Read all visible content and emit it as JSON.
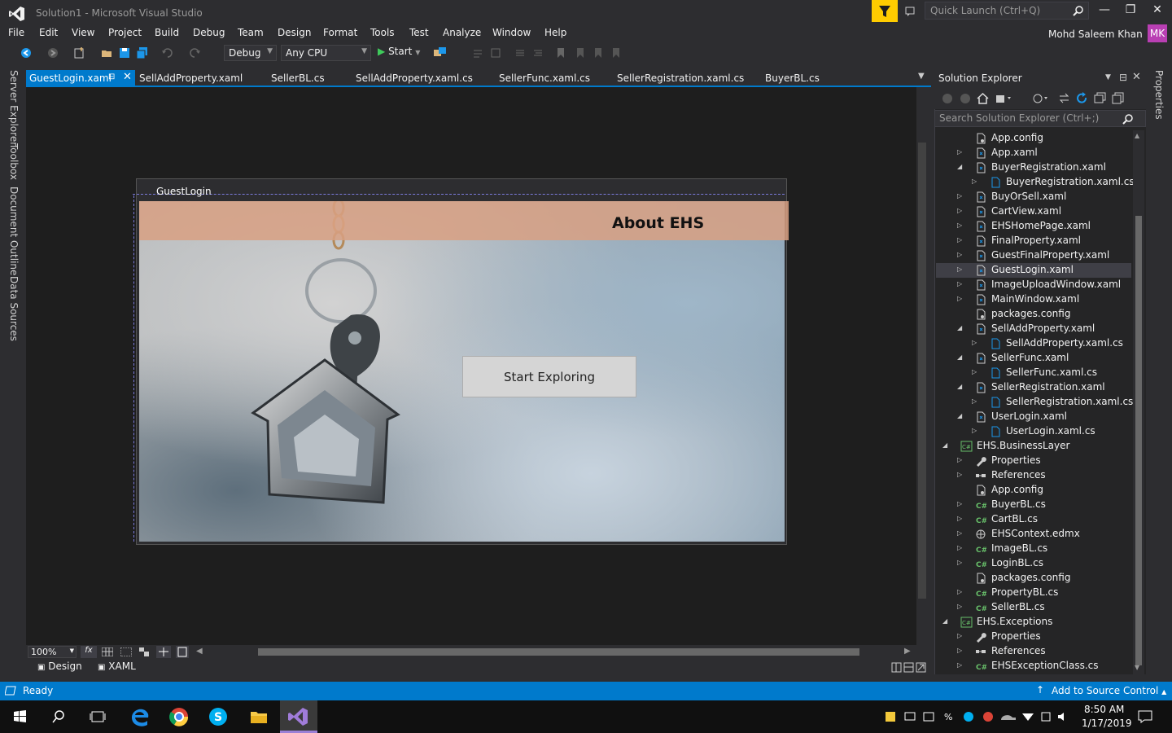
{
  "window": {
    "title": "Solution1 - Microsoft Visual Studio"
  },
  "quick_launch": {
    "placeholder": "Quick Launch (Ctrl+Q)"
  },
  "menu": [
    "File",
    "Edit",
    "View",
    "Project",
    "Build",
    "Debug",
    "Team",
    "Design",
    "Format",
    "Tools",
    "Test",
    "Analyze",
    "Window",
    "Help"
  ],
  "user": {
    "name": "Mohd Saleem Khan",
    "initials": "MK"
  },
  "toolbar": {
    "config": "Debug",
    "platform": "Any CPU",
    "start": "Start"
  },
  "left_tabs": [
    "Server Explorer",
    "Toolbox",
    "Document Outline",
    "Data Sources"
  ],
  "right_tabs": [
    "Properties"
  ],
  "doc_tabs": [
    "GuestLogin.xaml",
    "SellAddProperty.xaml",
    "SellerBL.cs",
    "SellAddProperty.xaml.cs",
    "SellerFunc.xaml.cs",
    "SellerRegistration.xaml.cs",
    "BuyerBL.cs"
  ],
  "designer": {
    "window_title": "GuestLogin",
    "header": "About EHS",
    "button": "Start Exploring",
    "zoom": "100%",
    "view_design": "Design",
    "view_xaml": "XAML"
  },
  "solution_explorer": {
    "title": "Solution Explorer",
    "search_placeholder": "Search Solution Explorer (Ctrl+;)",
    "items": [
      {
        "label": "App.config",
        "icon": "config-icon",
        "level": 2,
        "exp": ""
      },
      {
        "label": "App.xaml",
        "icon": "xaml-icon",
        "level": 2,
        "exp": "collapsed"
      },
      {
        "label": "BuyerRegistration.xaml",
        "icon": "xaml-icon",
        "level": 2,
        "exp": "expanded"
      },
      {
        "label": "BuyerRegistration.xaml.cs",
        "icon": "cs-file-icon",
        "level": 3,
        "exp": "collapsed"
      },
      {
        "label": "BuyOrSell.xaml",
        "icon": "xaml-icon",
        "level": 2,
        "exp": "collapsed"
      },
      {
        "label": "CartView.xaml",
        "icon": "xaml-icon",
        "level": 2,
        "exp": "collapsed"
      },
      {
        "label": "EHSHomePage.xaml",
        "icon": "xaml-icon",
        "level": 2,
        "exp": "collapsed"
      },
      {
        "label": "FinalProperty.xaml",
        "icon": "xaml-icon",
        "level": 2,
        "exp": "collapsed"
      },
      {
        "label": "GuestFinalProperty.xaml",
        "icon": "xaml-icon",
        "level": 2,
        "exp": "collapsed"
      },
      {
        "label": "GuestLogin.xaml",
        "icon": "xaml-icon",
        "level": 2,
        "exp": "collapsed",
        "selected": true
      },
      {
        "label": "ImageUploadWindow.xaml",
        "icon": "xaml-icon",
        "level": 2,
        "exp": "collapsed"
      },
      {
        "label": "MainWindow.xaml",
        "icon": "xaml-icon",
        "level": 2,
        "exp": "collapsed"
      },
      {
        "label": "packages.config",
        "icon": "config-icon",
        "level": 2,
        "exp": ""
      },
      {
        "label": "SellAddProperty.xaml",
        "icon": "xaml-icon",
        "level": 2,
        "exp": "expanded"
      },
      {
        "label": "SellAddProperty.xaml.cs",
        "icon": "cs-file-icon",
        "level": 3,
        "exp": "collapsed"
      },
      {
        "label": "SellerFunc.xaml",
        "icon": "xaml-icon",
        "level": 2,
        "exp": "expanded"
      },
      {
        "label": "SellerFunc.xaml.cs",
        "icon": "cs-file-icon",
        "level": 3,
        "exp": "collapsed"
      },
      {
        "label": "SellerRegistration.xaml",
        "icon": "xaml-icon",
        "level": 2,
        "exp": "expanded"
      },
      {
        "label": "SellerRegistration.xaml.cs",
        "icon": "cs-file-icon",
        "level": 3,
        "exp": "collapsed"
      },
      {
        "label": "UserLogin.xaml",
        "icon": "xaml-icon",
        "level": 2,
        "exp": "expanded"
      },
      {
        "label": "UserLogin.xaml.cs",
        "icon": "cs-file-icon",
        "level": 3,
        "exp": "collapsed"
      },
      {
        "label": "EHS.BusinessLayer",
        "icon": "csharp-project-icon",
        "level": 1,
        "exp": "expanded"
      },
      {
        "label": "Properties",
        "icon": "wrench-icon",
        "level": 2,
        "exp": "collapsed"
      },
      {
        "label": "References",
        "icon": "references-icon",
        "level": 2,
        "exp": "collapsed"
      },
      {
        "label": "App.config",
        "icon": "config-icon",
        "level": 2,
        "exp": ""
      },
      {
        "label": "BuyerBL.cs",
        "icon": "csharp-icon",
        "level": 2,
        "exp": "collapsed"
      },
      {
        "label": "CartBL.cs",
        "icon": "csharp-icon",
        "level": 2,
        "exp": "collapsed"
      },
      {
        "label": "EHSContext.edmx",
        "icon": "edmx-icon",
        "level": 2,
        "exp": "collapsed"
      },
      {
        "label": "ImageBL.cs",
        "icon": "csharp-icon",
        "level": 2,
        "exp": "collapsed"
      },
      {
        "label": "LoginBL.cs",
        "icon": "csharp-icon",
        "level": 2,
        "exp": "collapsed"
      },
      {
        "label": "packages.config",
        "icon": "config-icon",
        "level": 2,
        "exp": ""
      },
      {
        "label": "PropertyBL.cs",
        "icon": "csharp-icon",
        "level": 2,
        "exp": "collapsed"
      },
      {
        "label": "SellerBL.cs",
        "icon": "csharp-icon",
        "level": 2,
        "exp": "collapsed"
      },
      {
        "label": "EHS.Exceptions",
        "icon": "csharp-project-icon",
        "level": 1,
        "exp": "expanded"
      },
      {
        "label": "Properties",
        "icon": "wrench-icon",
        "level": 2,
        "exp": "collapsed"
      },
      {
        "label": "References",
        "icon": "references-icon",
        "level": 2,
        "exp": "collapsed"
      },
      {
        "label": "EHSExceptionClass.cs",
        "icon": "csharp-icon",
        "level": 2,
        "exp": "collapsed"
      }
    ]
  },
  "status": {
    "text": "Ready",
    "source_control": "Add to Source Control"
  },
  "taskbar": {
    "time": "8:50 AM",
    "date": "1/17/2019"
  },
  "colors": {
    "accent": "#007acc",
    "vs_purple": "#68217a",
    "highlight": "#ffcc00",
    "avatar": "#b93fb3"
  }
}
